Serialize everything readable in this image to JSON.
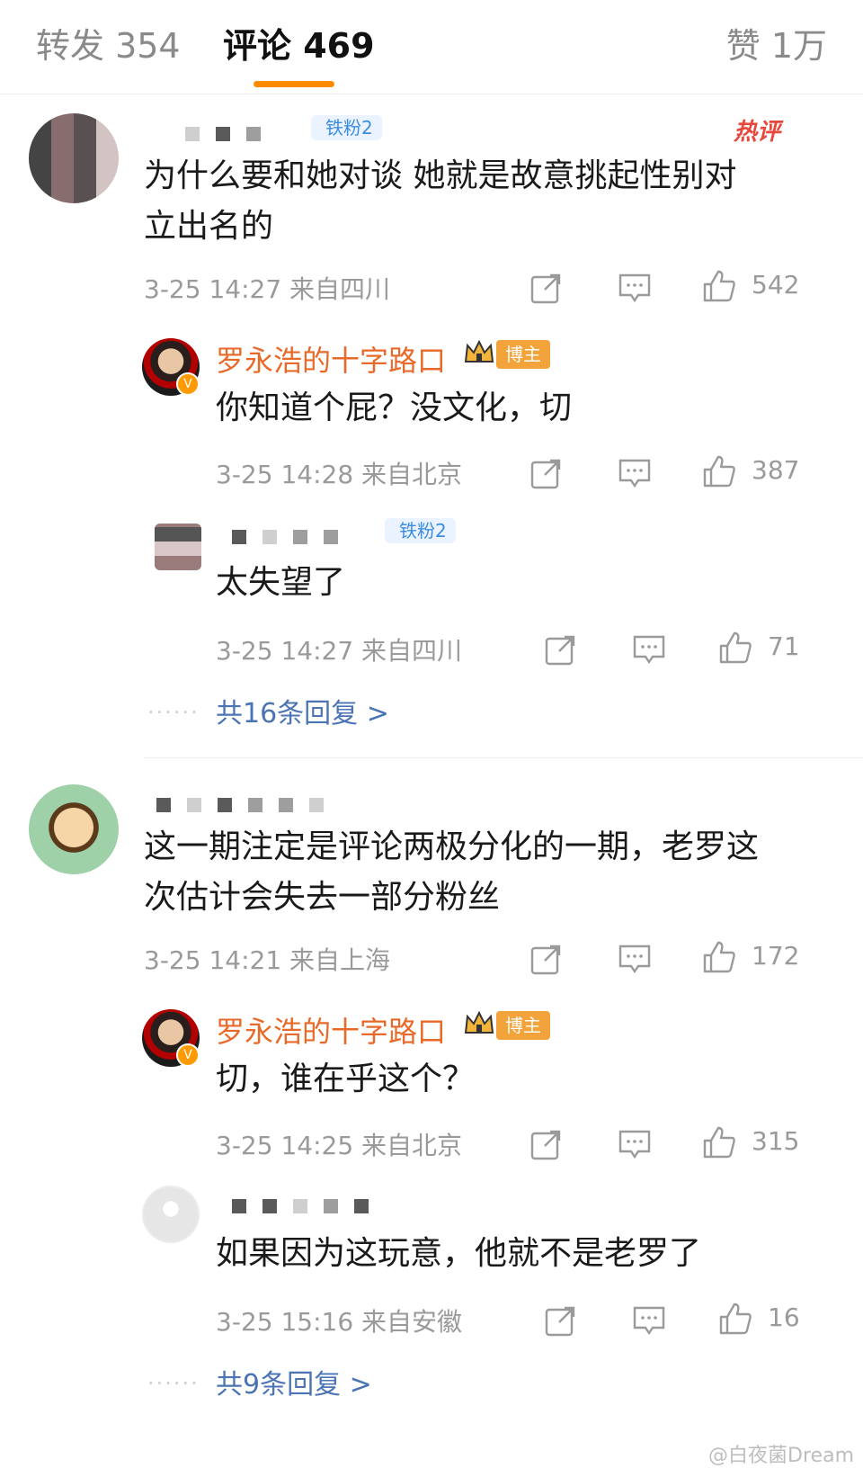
{
  "tabs": {
    "repost": "转发 354",
    "comments": "评论 469",
    "likes": "赞 1万"
  },
  "comments": [
    {
      "fan_badge": "铁粉2",
      "hot_badge": "热评",
      "text_line1": "为什么要和她对谈  她就是故意挑起性别对",
      "text_line2": "立出名的",
      "meta": "3-25 14:27  来自四川",
      "likes": "542",
      "replies": [
        {
          "author": "罗永浩的十字路口",
          "badge": "博主",
          "text": "你知道个屁？没文化，切",
          "meta": "3-25 14:28  来自北京",
          "likes": "387"
        },
        {
          "fan_badge": "铁粉2",
          "text": "太失望了",
          "meta": "3-25 14:27  来自四川",
          "likes": "71"
        }
      ],
      "more": "共16条回复 >"
    },
    {
      "text_line1": "这一期注定是评论两极分化的一期，老罗这",
      "text_line2": "次估计会失去一部分粉丝",
      "meta": "3-25 14:21  来自上海",
      "likes": "172",
      "replies": [
        {
          "author": "罗永浩的十字路口",
          "badge": "博主",
          "text": "切，谁在乎这个？",
          "meta": "3-25 14:25  来自北京",
          "likes": "315"
        },
        {
          "text": "如果因为这玩意，他就不是老罗了",
          "meta": "3-25 15:16  来自安徽",
          "likes": "16"
        }
      ],
      "more": "共9条回复 >"
    }
  ],
  "dots": "······",
  "watermark": "@白夜菌Dream",
  "icons": [
    "repost-icon",
    "comment-icon",
    "like-icon",
    "crown-icon"
  ],
  "colors": {
    "accent": "#ff8c00",
    "author": "#e86a2a",
    "link": "#4b74b4",
    "fan": "#3c8de0",
    "hot": "#e8473c"
  }
}
